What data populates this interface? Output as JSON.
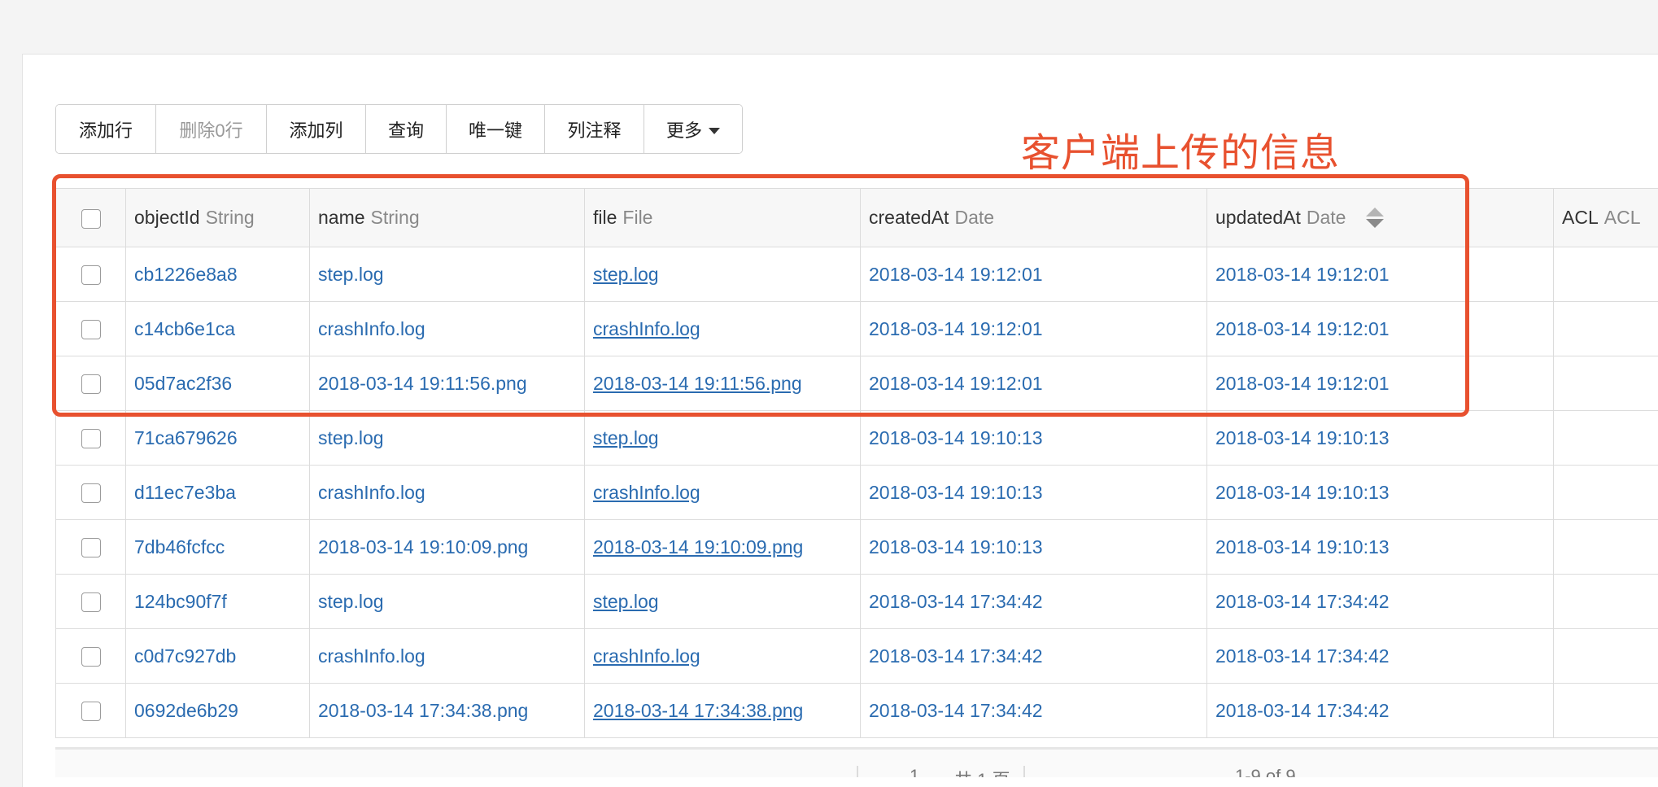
{
  "toolbar": {
    "add_row": "添加行",
    "delete_rows": "删除0行",
    "add_column": "添加列",
    "query": "查询",
    "unique_key": "唯一键",
    "column_comment": "列注释",
    "more": "更多"
  },
  "annotation": "客户端上传的信息",
  "columns": [
    {
      "name": "objectId",
      "type": "String"
    },
    {
      "name": "name",
      "type": "String"
    },
    {
      "name": "file",
      "type": "File"
    },
    {
      "name": "createdAt",
      "type": "Date"
    },
    {
      "name": "updatedAt",
      "type": "Date"
    },
    {
      "name": "ACL",
      "type": "ACL"
    }
  ],
  "rows": [
    {
      "objectId": "cb1226e8a8",
      "name": "step.log",
      "file": "step.log",
      "createdAt": "2018-03-14 19:12:01",
      "updatedAt": "2018-03-14 19:12:01"
    },
    {
      "objectId": "c14cb6e1ca",
      "name": "crashInfo.log",
      "file": "crashInfo.log",
      "createdAt": "2018-03-14 19:12:01",
      "updatedAt": "2018-03-14 19:12:01"
    },
    {
      "objectId": "05d7ac2f36",
      "name": "2018-03-14 19:11:56.png",
      "file": "2018-03-14 19:11:56.png",
      "createdAt": "2018-03-14 19:12:01",
      "updatedAt": "2018-03-14 19:12:01"
    },
    {
      "objectId": "71ca679626",
      "name": "step.log",
      "file": "step.log",
      "createdAt": "2018-03-14 19:10:13",
      "updatedAt": "2018-03-14 19:10:13"
    },
    {
      "objectId": "d11ec7e3ba",
      "name": "crashInfo.log",
      "file": "crashInfo.log",
      "createdAt": "2018-03-14 19:10:13",
      "updatedAt": "2018-03-14 19:10:13"
    },
    {
      "objectId": "7db46fcfcc",
      "name": "2018-03-14 19:10:09.png",
      "file": "2018-03-14 19:10:09.png",
      "createdAt": "2018-03-14 19:10:13",
      "updatedAt": "2018-03-14 19:10:13"
    },
    {
      "objectId": "124bc90f7f",
      "name": "step.log",
      "file": "step.log",
      "createdAt": "2018-03-14 17:34:42",
      "updatedAt": "2018-03-14 17:34:42"
    },
    {
      "objectId": "c0d7c927db",
      "name": "crashInfo.log",
      "file": "crashInfo.log",
      "createdAt": "2018-03-14 17:34:42",
      "updatedAt": "2018-03-14 17:34:42"
    },
    {
      "objectId": "0692de6b29",
      "name": "2018-03-14 17:34:38.png",
      "file": "2018-03-14 17:34:38.png",
      "createdAt": "2018-03-14 17:34:42",
      "updatedAt": "2018-03-14 17:34:42"
    }
  ],
  "pager": {
    "page": "1",
    "total_pages": "共 1 页",
    "range": "1-9 of 9"
  },
  "colors": {
    "annotation": "#e8512f",
    "link": "#2a6bb0"
  },
  "icons": {
    "more_caret": "caret-down-icon",
    "sort": "sort-icon"
  }
}
